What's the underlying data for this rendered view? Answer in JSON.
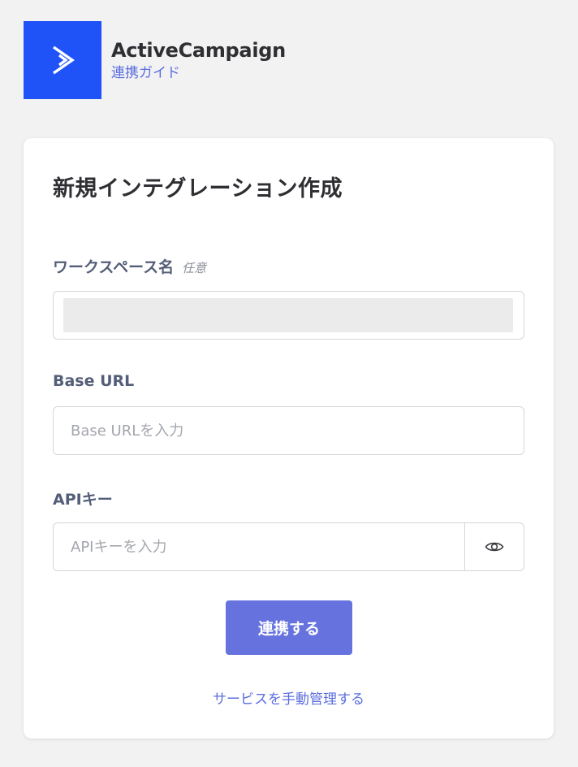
{
  "header": {
    "brand_name": "ActiveCampaign",
    "guide_link": "連携ガイド",
    "logo_icon": "chevron-right-icon",
    "logo_color": "#1f52f7"
  },
  "card": {
    "title": "新規インテグレーション作成",
    "workspace": {
      "label": "ワークスペース名",
      "optional": "任意",
      "value": ""
    },
    "base_url": {
      "label": "Base URL",
      "placeholder": "Base URLを入力",
      "value": ""
    },
    "api_key": {
      "label": "APIキー",
      "placeholder": "APIキーを入力",
      "value": "",
      "toggle_icon": "eye-icon"
    },
    "submit_label": "連携する",
    "manual_link": "サービスを手動管理する",
    "accent_color": "#6672de"
  }
}
